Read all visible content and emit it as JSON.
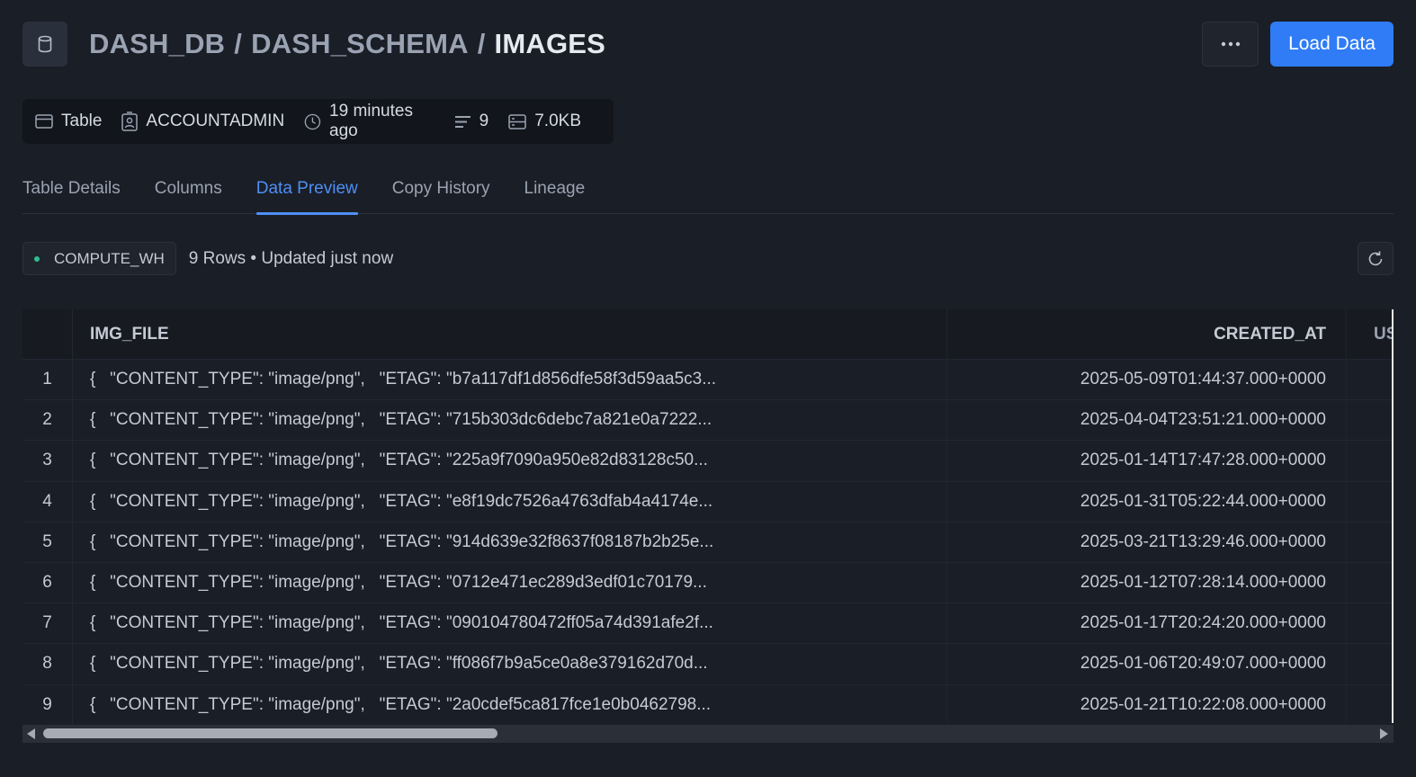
{
  "header": {
    "db_icon": "database-icon",
    "crumbs": [
      "DASH_DB",
      "DASH_SCHEMA",
      "IMAGES"
    ],
    "separator": "/",
    "more_icon": "more-horizontal-icon",
    "load_button": "Load Data"
  },
  "meta": {
    "type": "Table",
    "owner": "ACCOUNTADMIN",
    "modified": "19 minutes ago",
    "rows": "9",
    "size": "7.0KB"
  },
  "tabs": [
    {
      "label": "Table Details",
      "active": false
    },
    {
      "label": "Columns",
      "active": false
    },
    {
      "label": "Data Preview",
      "active": true
    },
    {
      "label": "Copy History",
      "active": false
    },
    {
      "label": "Lineage",
      "active": false
    }
  ],
  "status": {
    "warehouse": "COMPUTE_WH",
    "text": "9 Rows • Updated just now",
    "refresh_icon": "refresh-icon"
  },
  "table": {
    "columns": [
      "IMG_FILE",
      "CREATED_AT",
      "US"
    ],
    "rows": [
      {
        "idx": "1",
        "img_file": "{   \"CONTENT_TYPE\": \"image/png\",   \"ETAG\": \"b7a117df1d856dfe58f3d59aa5c3...",
        "created_at": "2025-05-09T01:44:37.000+0000"
      },
      {
        "idx": "2",
        "img_file": "{   \"CONTENT_TYPE\": \"image/png\",   \"ETAG\": \"715b303dc6debc7a821e0a7222...",
        "created_at": "2025-04-04T23:51:21.000+0000"
      },
      {
        "idx": "3",
        "img_file": "{   \"CONTENT_TYPE\": \"image/png\",   \"ETAG\": \"225a9f7090a950e82d83128c50...",
        "created_at": "2025-01-14T17:47:28.000+0000"
      },
      {
        "idx": "4",
        "img_file": "{   \"CONTENT_TYPE\": \"image/png\",   \"ETAG\": \"e8f19dc7526a4763dfab4a4174e...",
        "created_at": "2025-01-31T05:22:44.000+0000"
      },
      {
        "idx": "5",
        "img_file": "{   \"CONTENT_TYPE\": \"image/png\",   \"ETAG\": \"914d639e32f8637f08187b2b25e...",
        "created_at": "2025-03-21T13:29:46.000+0000"
      },
      {
        "idx": "6",
        "img_file": "{   \"CONTENT_TYPE\": \"image/png\",   \"ETAG\": \"0712e471ec289d3edf01c70179...",
        "created_at": "2025-01-12T07:28:14.000+0000"
      },
      {
        "idx": "7",
        "img_file": "{   \"CONTENT_TYPE\": \"image/png\",   \"ETAG\": \"090104780472ff05a74d391afe2f...",
        "created_at": "2025-01-17T20:24:20.000+0000"
      },
      {
        "idx": "8",
        "img_file": "{   \"CONTENT_TYPE\": \"image/png\",   \"ETAG\": \"ff086f7b9a5ce0a8e379162d70d...",
        "created_at": "2025-01-06T20:49:07.000+0000"
      },
      {
        "idx": "9",
        "img_file": "{   \"CONTENT_TYPE\": \"image/png\",   \"ETAG\": \"2a0cdef5ca817fce1e0b0462798...",
        "created_at": "2025-01-21T10:22:08.000+0000"
      }
    ]
  },
  "colors": {
    "accent": "#2f7cf6",
    "tab_active": "#4d8ff7",
    "warehouse_dot": "#2fbf8f",
    "background": "#1a1e26"
  }
}
